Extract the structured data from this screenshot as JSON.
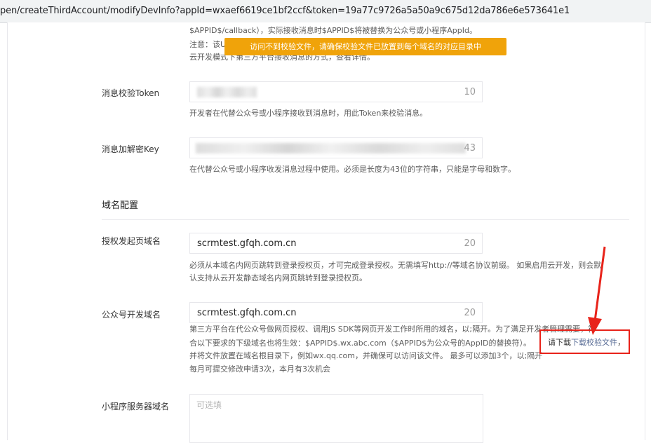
{
  "browser": {
    "url": "pen/createThirdAccount/modifyDevInfo?appId=wxaef6619ce1bf2ccf&token=19a77c9726a5a50a9c675d12da786e6e573641e1"
  },
  "toast": {
    "text": "访问不到校验文件，请确保校验文件已放置到每个域名的对应目录中"
  },
  "top_hint": {
    "line1": "$APPID$/callback），实际接收消息时$APPID$将被替换为公众号或小程序AppId。",
    "line2_prefix": "注意：该U",
    "line3": "云开发模式下第三方平台接收消息的方式，查看详情。"
  },
  "token_field": {
    "label": "消息校验Token",
    "count": "10",
    "hint": "开发者在代替公众号或小程序接收到消息时，用此Token来校验消息。"
  },
  "key_field": {
    "label": "消息加解密Key",
    "count": "43",
    "hint": "在代替公众号或小程序收发消息过程中使用。必须是长度为43位的字符串，只能是字母和数字。"
  },
  "domain_section": {
    "title": "域名配置"
  },
  "auth_domain": {
    "label": "授权发起页域名",
    "value": "scrmtest.gfqh.com.cn",
    "count": "20",
    "hint_line1": "必须从本域名内网页跳转到登录授权页，才可完成登录授权。无需填写http://等域名协议前缀。 如果启用云开发，则会默",
    "hint_line2": "认支持从云开发静态域名内网页跳转到登录授权页。"
  },
  "mp_domain": {
    "label": "公众号开发域名",
    "value": "scrmtest.gfqh.com.cn",
    "count": "20",
    "hint_line1": "第三方平台在代公众号做网页授权、调用JS SDK等网页开发工作时所用的域名，以;隔开。为了满足开发者管理需要，符",
    "hint_line2": "合以下要求的下级域名也将生效：$APPID$.wx.abc.com（$APPID$为公众号的AppID的替换符）。",
    "hint_line3": "并将文件放置在域名根目录下，例如wx.qq.com，并确保可以访问该文件。 最多可以添加3个，以;隔开",
    "hint_line4": "每月可提交修改申请3次，本月有3次机会",
    "download_prefix": "请下载",
    "download_link": "下载校验文件",
    "download_suffix": "，"
  },
  "mini_server_domain": {
    "label": "小程序服务器域名",
    "placeholder": "可选填"
  },
  "colors": {
    "toast_bg": "#f0a30a",
    "annotation_red": "#e8231a",
    "link": "#576b95"
  }
}
